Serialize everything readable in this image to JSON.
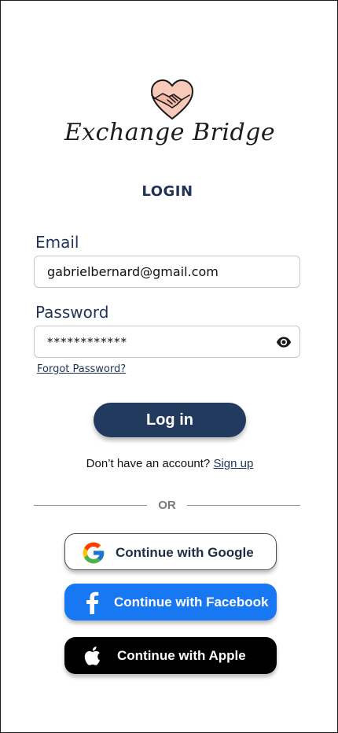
{
  "app": {
    "brand_name": "Exchange Bridge",
    "logo_icon": "handshake-heart-icon",
    "colors": {
      "primary": "#223a5e",
      "facebook": "#1877f2",
      "apple": "#000000",
      "heart": "#f7c9b8"
    }
  },
  "login": {
    "title": "LOGIN",
    "email_label": "Email",
    "email_value": "gabrielbernard@gmail.com",
    "password_label": "Password",
    "password_value": "************",
    "forgot_password": "Forgot Password?",
    "login_button": "Log in",
    "no_account_text": "Don’t have an account?",
    "sign_up": "Sign up",
    "or": "OR"
  },
  "social": {
    "google": "Continue with Google",
    "facebook": "Continue with Facebook",
    "apple": "Continue with Apple"
  }
}
